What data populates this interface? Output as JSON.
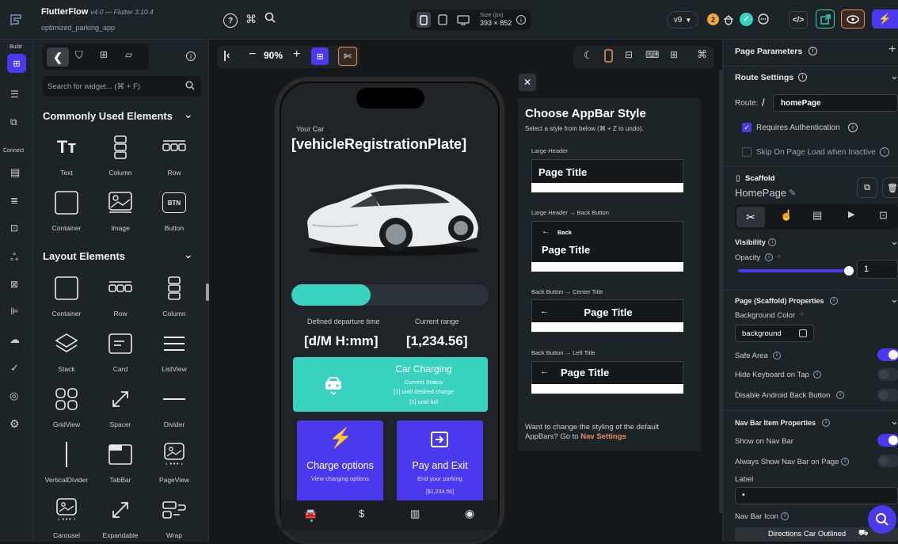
{
  "app": {
    "name": "FlutterFlow",
    "version": "v4.0 — Flutter 3.10.4",
    "project": "optimized_parking_app"
  },
  "topbar": {
    "size_label": "Size (px)",
    "size_value": "393 × 852",
    "version_badge": "v9",
    "warning_count": "2",
    "colors": {
      "accent": "#4b39ef",
      "teal": "#39d2c0",
      "orange": "#ee8b60"
    }
  },
  "rail": {
    "build": "Build",
    "connect": "Connect"
  },
  "widgets": {
    "search_placeholder": "Search for widget... (⌘ + F)",
    "common_title": "Commonly Used Elements",
    "layout_title": "Layout Elements",
    "common": [
      "Text",
      "Column",
      "Row",
      "Container",
      "Image",
      "Button"
    ],
    "layout": [
      "Container",
      "Row",
      "Column",
      "Stack",
      "Card",
      "ListView",
      "GridView",
      "Spacer",
      "Divider",
      "VerticalDivider",
      "TabBar",
      "PageView",
      "Carousel",
      "Expandable",
      "Wrap"
    ]
  },
  "canvas": {
    "zoom": "90%"
  },
  "phone": {
    "your_car": "Your Car",
    "plate": "[vehicleRegistrationPlate]",
    "progress": 0.4,
    "departure_label": "Defined departure time",
    "range_label": "Current range",
    "departure_value": "[d/M H:mm]",
    "range_value": "[1,234.56]",
    "charging_title": "Car Charging",
    "charging_status": "Current Status",
    "charging_line1": "[1] until desired charge",
    "charging_line2": "[1] until full",
    "btn1_title": "Charge options",
    "btn1_sub": "View charging options",
    "btn2_title": "Pay and Exit",
    "btn2_sub": "End your parking",
    "btn2_amount": "[$1,234.56]",
    "btn_icon": "BTN"
  },
  "appbar": {
    "title": "Choose AppBar Style",
    "subtitle": "Select a style from below (⌘ + Z to undo).",
    "opt1_label": "Large Header",
    "opt2_label": "Large Header → Back Button",
    "opt3_label": "Back Button → Center Title",
    "opt4_label": "Back Button → Left Title",
    "page_title": "Page Title",
    "back": "Back",
    "footer": "Want to change the styling of the default AppBars? Go to",
    "footer_link": "Nav Settings"
  },
  "props": {
    "page_params": "Page Parameters",
    "route_settings": "Route Settings",
    "route_label": "Route:",
    "route_slash": "/",
    "route_value": "homePage",
    "requires_auth": "Requires Authentication",
    "skip_on_load": "Skip On Page Load when Inactive",
    "scaffold": "Scaffold",
    "page_name": "HomePage",
    "visibility": "Visibility",
    "opacity": "Opacity",
    "opacity_value": "1",
    "scaffold_props": "Page (Scaffold) Properties",
    "bg_color": "Background Color",
    "bg_value": "background",
    "safe_area": "Safe Area",
    "hide_keyboard": "Hide Keyboard on Tap",
    "disable_back": "Disable Android Back Button",
    "nav_props": "Nav Bar Item Properties",
    "show_nav": "Show on Nav Bar",
    "always_show": "Always Show Nav Bar on Page",
    "label": "Label",
    "label_value": "•",
    "nav_icon": "Nav Bar Icon",
    "nav_icon_value": "Directions Car Outlined"
  }
}
